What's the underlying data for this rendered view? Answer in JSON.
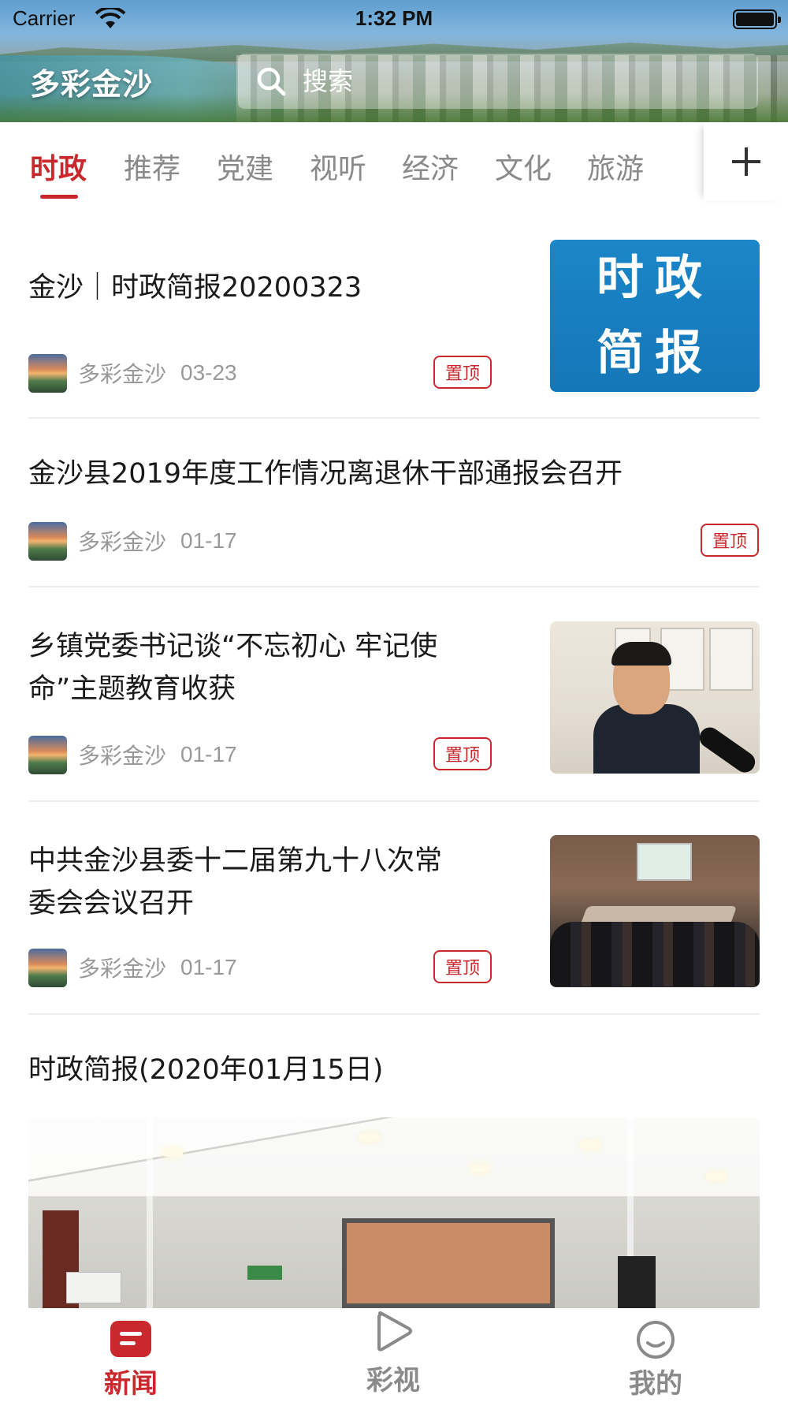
{
  "status_bar": {
    "carrier": "Carrier",
    "time": "1:32 PM"
  },
  "header": {
    "app_title": "多彩金沙",
    "search": {
      "placeholder": "搜索"
    }
  },
  "tabs": [
    "时政",
    "推荐",
    "党建",
    "视听",
    "经济",
    "文化",
    "旅游"
  ],
  "active_tab": "时政",
  "articles": [
    {
      "title": "金沙｜时政简报20200323",
      "source": "多彩金沙",
      "date": "03-23",
      "badge": "置顶",
      "thumb_text": [
        "时政",
        "简报"
      ]
    },
    {
      "title": "金沙县2019年度工作情况离退休干部通报会召开",
      "source": "多彩金沙",
      "date": "01-17",
      "badge": "置顶"
    },
    {
      "title_lines": [
        "乡镇党委书记谈“不忘初心 牢记使",
        "命”主题教育收获"
      ],
      "source": "多彩金沙",
      "date": "01-17",
      "badge": "置顶"
    },
    {
      "title_lines": [
        "中共金沙县委十二届第九十八次常",
        "委会会议召开"
      ],
      "source": "多彩金沙",
      "date": "01-17",
      "badge": "置顶"
    },
    {
      "title": "时政简报(2020年01月15日)"
    }
  ],
  "bottom_nav": [
    {
      "label": "新闻",
      "active": true
    },
    {
      "label": "彩视",
      "active": false
    },
    {
      "label": "我的",
      "active": false
    }
  ],
  "colors": {
    "accent": "#c9282d",
    "inactive": "#8a8a8a",
    "meta": "#999999"
  }
}
